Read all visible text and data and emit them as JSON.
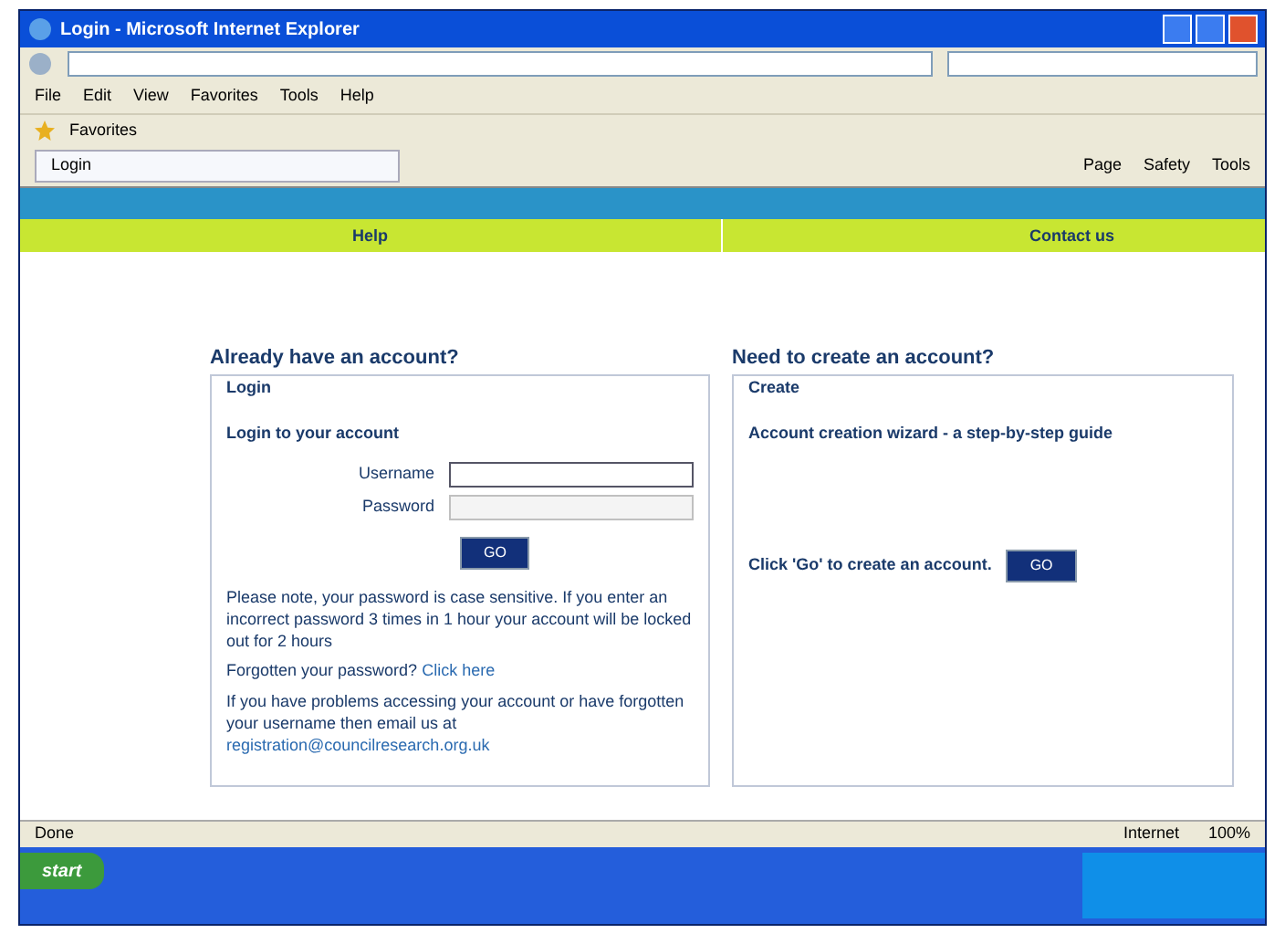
{
  "window": {
    "title": "Login - Microsoft Internet Explorer"
  },
  "menu": [
    "File",
    "Edit",
    "View",
    "Favorites",
    "Tools",
    "Help"
  ],
  "favorites_bar": {
    "label": "Favorites"
  },
  "tab": {
    "label": "Login"
  },
  "command_bar": [
    "Page",
    "Safety",
    "Tools"
  ],
  "site_nav": [
    {
      "label": "Help"
    },
    {
      "label": "Contact us"
    }
  ],
  "login": {
    "heading": "Already have an account?",
    "legend": "Login",
    "title": "Login to your account",
    "fields": [
      {
        "label": "Username",
        "focused": true
      },
      {
        "label": "Password",
        "focused": false
      }
    ],
    "button": "GO",
    "note": "Please note, your password is case sensitive. If you enter an incorrect password 3 times in 1 hour your account will be locked out for 2 hours",
    "forgot": "Forgotten your password?",
    "forgot_link": "Click here",
    "help": "If you have problems accessing your account or have forgotten your username then email us at",
    "email": "registration@councilresearch.org.uk"
  },
  "create": {
    "heading": "Need to create an account?",
    "legend": "Create",
    "title": "Account creation wizard - a step-by-step guide",
    "prompt": "Click 'Go' to create an account.",
    "button": "GO"
  },
  "status_bar": {
    "text": "Done",
    "zone": "Internet",
    "zoom": "100%"
  },
  "taskbar": {
    "start": "start"
  }
}
